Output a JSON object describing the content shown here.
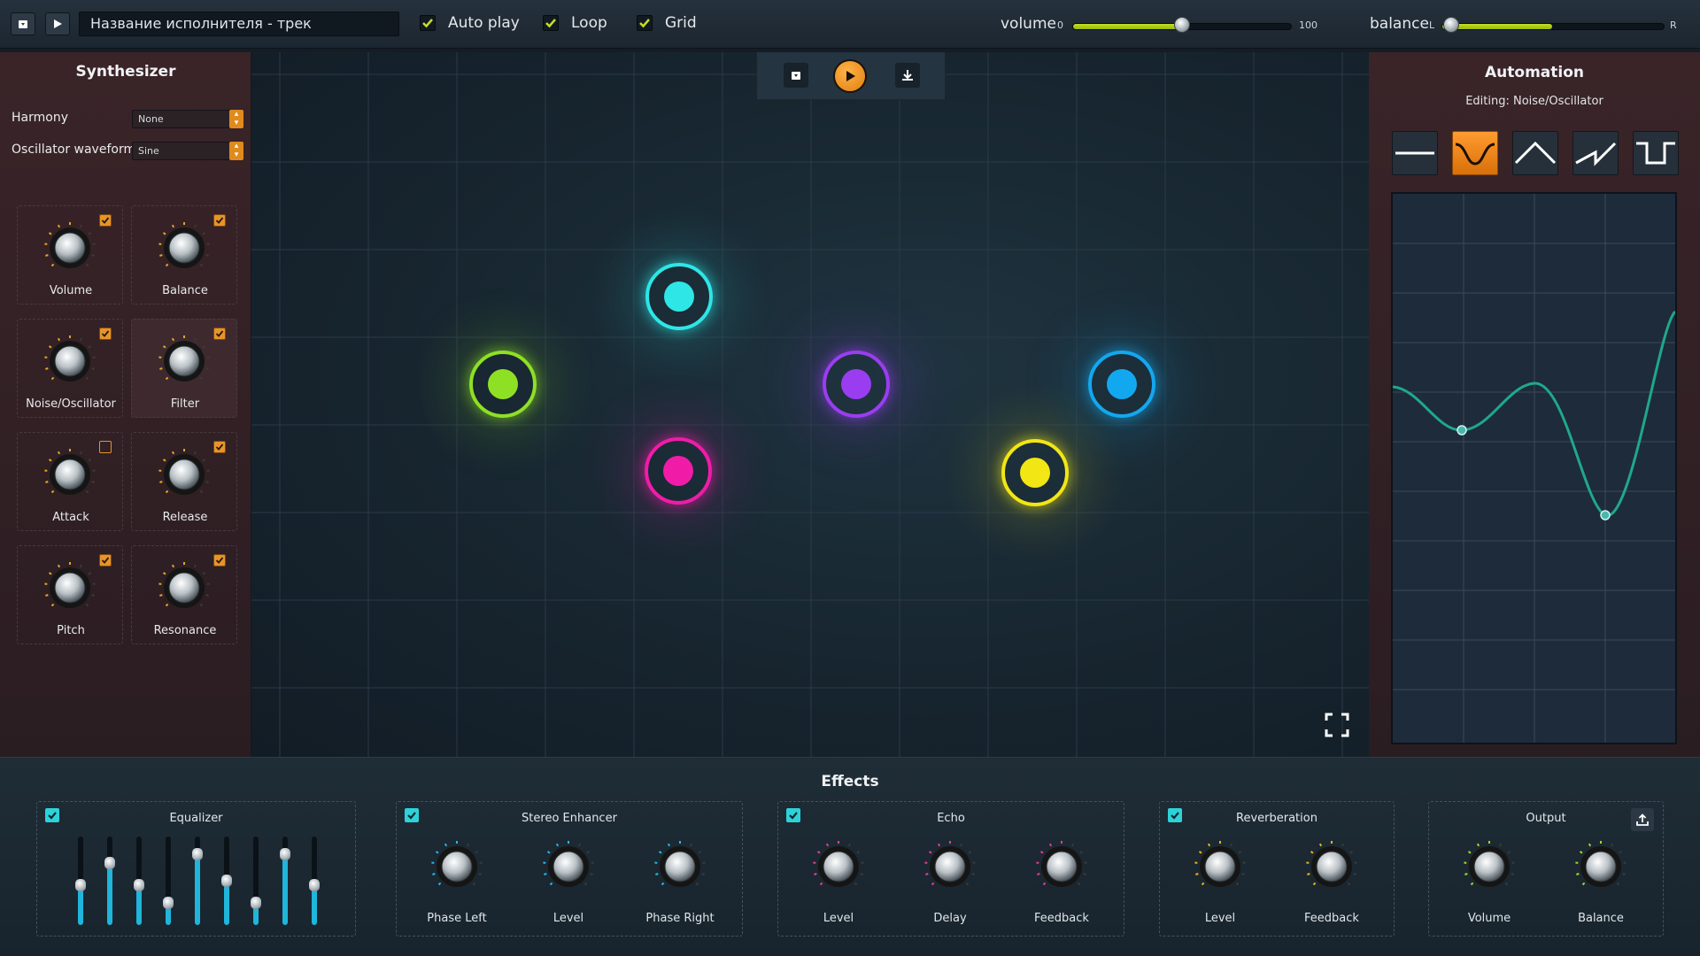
{
  "topbar": {
    "track_title": "Название исполнителя - трек",
    "checkboxes": [
      {
        "label": "Auto play",
        "checked": true
      },
      {
        "label": "Loop",
        "checked": true
      },
      {
        "label": "Grid",
        "checked": true
      }
    ],
    "volume": {
      "label": "volume",
      "min_label": "0",
      "max_label": "100",
      "value": 50
    },
    "balance": {
      "label": "balance",
      "left_label": "L",
      "right_label": "R",
      "value": 0.5
    }
  },
  "synth": {
    "title": "Synthesizer",
    "harmony": {
      "label": "Harmony",
      "value": "None"
    },
    "waveform": {
      "label": "Oscillator waveform",
      "value": "Sine"
    },
    "knobs": [
      {
        "label": "Volume",
        "enabled": true
      },
      {
        "label": "Balance",
        "enabled": true
      },
      {
        "label": "Noise/Oscillator",
        "enabled": true
      },
      {
        "label": "Filter",
        "enabled": true
      },
      {
        "label": "Attack",
        "enabled": false
      },
      {
        "label": "Release",
        "enabled": true
      },
      {
        "label": "Pitch",
        "enabled": true
      },
      {
        "label": "Resonance",
        "enabled": true
      }
    ]
  },
  "stage": {
    "nodes": [
      {
        "name": "cyan",
        "color": "#2ee6e6"
      },
      {
        "name": "green",
        "color": "#8ee024"
      },
      {
        "name": "purple",
        "color": "#9a3df0"
      },
      {
        "name": "blue",
        "color": "#12a8f0"
      },
      {
        "name": "magenta",
        "color": "#f01ca8"
      },
      {
        "name": "yellow",
        "color": "#f2e614"
      }
    ]
  },
  "automation": {
    "title": "Automation",
    "editing": "Editing: Noise/Oscillator",
    "waveforms": [
      "flat",
      "curve",
      "triangle",
      "sawtooth",
      "square"
    ],
    "selected": "curve",
    "accent": "#e8942a",
    "curve_color": "#1fa88a"
  },
  "effects": {
    "title": "Effects",
    "equalizer": {
      "title": "Equalizer",
      "enabled": true,
      "bands": [
        0.45,
        0.7,
        0.45,
        0.25,
        0.8,
        0.5,
        0.25,
        0.8,
        0.45
      ]
    },
    "stereo": {
      "title": "Stereo Enhancer",
      "enabled": true,
      "knobs": [
        "Phase Left",
        "Level",
        "Phase Right"
      ]
    },
    "echo": {
      "title": "Echo",
      "enabled": true,
      "knobs": [
        "Level",
        "Delay",
        "Feedback"
      ]
    },
    "reverb": {
      "title": "Reverberation",
      "enabled": true,
      "knobs": [
        "Level",
        "Feedback"
      ]
    },
    "output": {
      "title": "Output",
      "knobs": [
        "Volume",
        "Balance"
      ]
    },
    "colors": {
      "stereo": "#2ab4e8",
      "echo": "#e23c9a",
      "reverb": "#e8b21e",
      "output": "#a2d82a"
    }
  }
}
